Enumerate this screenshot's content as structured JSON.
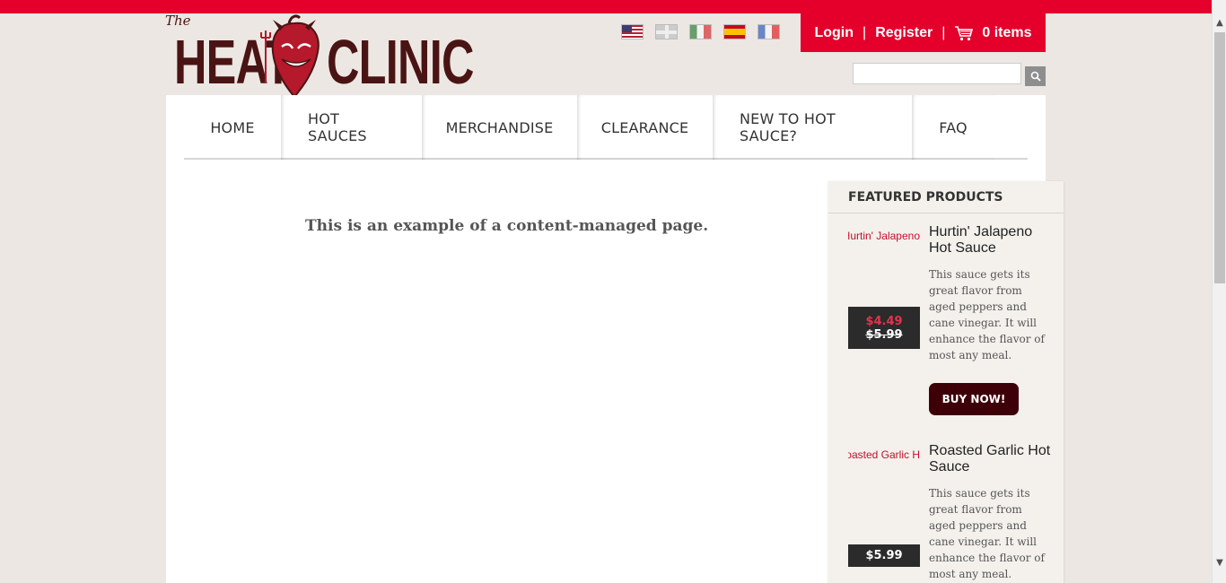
{
  "logo": {
    "the": "The",
    "heat": "HEAT",
    "clinic": "CLINIC"
  },
  "flags": [
    "us-flag-icon",
    "uk-flag-icon",
    "mexico-flag-icon",
    "spain-flag-icon",
    "france-flag-icon"
  ],
  "account": {
    "login": "Login",
    "separator": "|",
    "register": "Register",
    "cart": "0 items"
  },
  "search": {
    "placeholder": ""
  },
  "nav": {
    "items": [
      "HOME",
      "HOT SAUCES",
      "MERCHANDISE",
      "CLEARANCE",
      "NEW TO HOT SAUCE?",
      "FAQ"
    ]
  },
  "content": {
    "text": "This is an example of a content-managed page."
  },
  "sidebar": {
    "title": "FEATURED PRODUCTS",
    "products": [
      {
        "image_alt": "Hurtin' Jalapeno",
        "name": "Hurtin' Jalapeno Hot Sauce",
        "description": "This sauce gets its great flavor from aged peppers and cane vinegar. It will enhance the flavor of most any meal.",
        "sale_price": "$4.49",
        "price": "$5.99",
        "button": "BUY NOW!"
      },
      {
        "image_alt": "Roasted Garlic H",
        "name": "Roasted Garlic Hot Sauce",
        "description": "This sauce gets its great flavor from aged peppers and cane vinegar. It will enhance the flavor of most any meal.",
        "price": "$5.99"
      }
    ]
  },
  "colors": {
    "brand_red": "#e4002b",
    "dark_maroon": "#3e0008",
    "logo_brown": "#4a1414"
  }
}
